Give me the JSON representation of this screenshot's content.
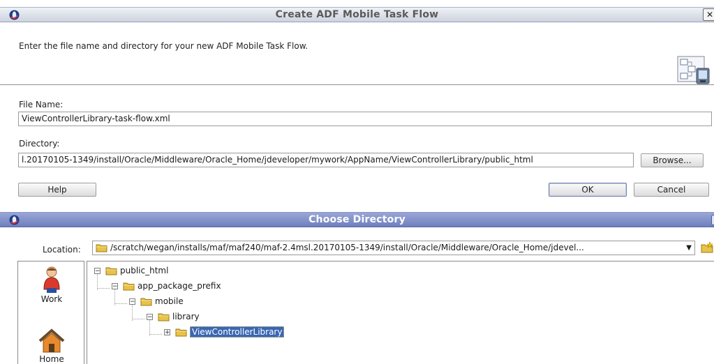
{
  "dialog1": {
    "title": "Create ADF Mobile Task Flow",
    "instructions": "Enter the file name and directory for your new ADF Mobile Task Flow.",
    "file_name_label": "File Name:",
    "file_name_value": "ViewControllerLibrary-task-flow.xml",
    "directory_label": "Directory:",
    "directory_value": "l.20170105-1349/install/Oracle/Middleware/Oracle_Home/jdeveloper/mywork/AppName/ViewControllerLibrary/public_html",
    "browse_label": "Browse...",
    "help_label": "Help",
    "ok_label": "OK",
    "cancel_label": "Cancel"
  },
  "dialog2": {
    "title": "Choose Directory",
    "location_label": "Location:",
    "location_value": "/scratch/wegan/installs/maf/maf240/maf-2.4msl.20170105-1349/install/Oracle/Middleware/Oracle_Home/jdevel...",
    "places": [
      {
        "label": "Work",
        "icon": "person-icon"
      },
      {
        "label": "Home",
        "icon": "house-icon"
      }
    ],
    "tree": [
      {
        "label": "public_html",
        "expanded": true
      },
      {
        "label": "app_package_prefix",
        "expanded": true
      },
      {
        "label": "mobile",
        "expanded": true
      },
      {
        "label": "library",
        "expanded": true
      },
      {
        "label": "ViewControllerLibrary",
        "expanded": false,
        "selected": true
      }
    ]
  },
  "colors": {
    "active_titlebar": "#6e7fbe",
    "inactive_titlebar": "#cdd3de",
    "selection": "#3a66b3",
    "folder": "#e8c24a"
  }
}
